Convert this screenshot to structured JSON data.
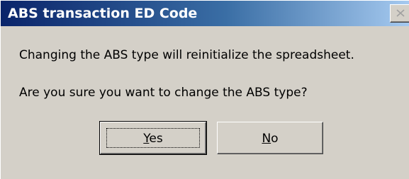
{
  "window": {
    "title": "ABS transaction ED Code",
    "close_symbol": "×"
  },
  "message": {
    "line1": "Changing the ABS type will reinitialize the spreadsheet.",
    "line2": "Are you sure you want to change the ABS type?"
  },
  "buttons": {
    "yes": {
      "mnemonic": "Y",
      "rest": "es",
      "label": "Yes"
    },
    "no": {
      "mnemonic": "N",
      "rest": "o",
      "label": "No"
    }
  },
  "colors": {
    "title_gradient_start": "#0a246a",
    "title_gradient_end": "#a6caf0",
    "dialog_face": "#d4d0c8",
    "title_text": "#ffffff"
  },
  "icons": {
    "close": "close-icon"
  }
}
